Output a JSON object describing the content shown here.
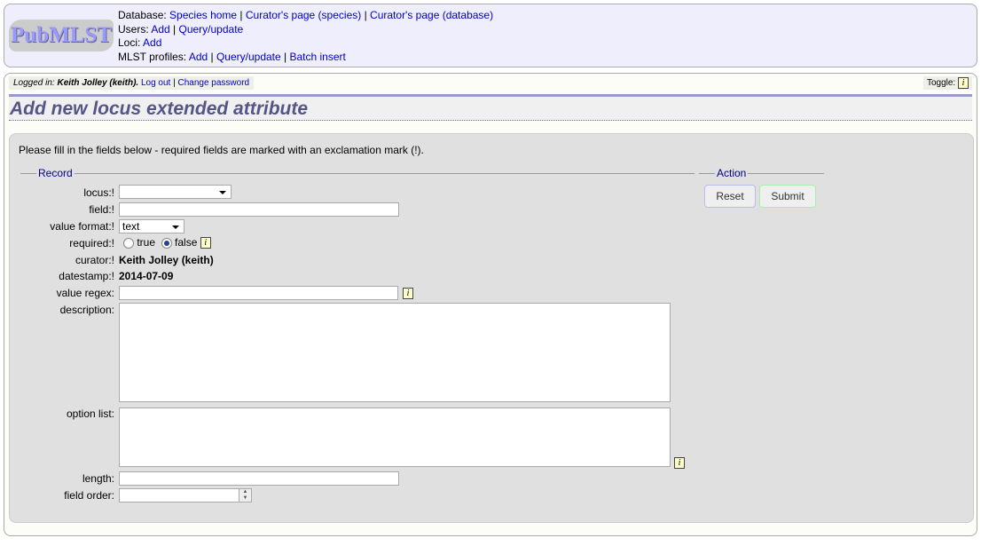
{
  "header": {
    "logo_text": "PubMLST",
    "rows": [
      {
        "label": "Database:",
        "links": [
          "Species home",
          "Curator's page (species)",
          "Curator's page (database)"
        ]
      },
      {
        "label": "Users:",
        "links": [
          "Add",
          "Query/update"
        ]
      },
      {
        "label": "Loci:",
        "links": [
          "Add"
        ]
      },
      {
        "label": "MLST profiles:",
        "links": [
          "Add",
          "Query/update",
          "Batch insert"
        ]
      }
    ]
  },
  "login": {
    "prefix": "Logged in: ",
    "user": "Keith Jolley (keith).",
    "logout": "Log out",
    "change_password": "Change password"
  },
  "toggle": {
    "label": "Toggle:",
    "icon": "info-icon"
  },
  "page_title": "Add new locus extended attribute",
  "form": {
    "intro": "Please fill in the fields below - required fields are marked with an exclamation mark (!).",
    "record_legend": "Record",
    "action_legend": "Action",
    "labels": {
      "locus": "locus:!",
      "field": "field:!",
      "value_format": "value format:!",
      "required": "required:!",
      "curator": "curator:!",
      "datestamp": "datestamp:!",
      "value_regex": "value regex:",
      "description": "description:",
      "option_list": "option list:",
      "length": "length:",
      "field_order": "field order:"
    },
    "values": {
      "locus": "",
      "field": "",
      "value_format": "text",
      "required_true": "true",
      "required_false": "false",
      "required_selected": "false",
      "curator": "Keith Jolley (keith)",
      "datestamp": "2014-07-09",
      "value_regex": "",
      "description": "",
      "option_list": "",
      "length": "",
      "field_order": ""
    },
    "reset": "Reset",
    "submit": "Submit"
  },
  "colors": {
    "header_bg": "#eeeefd",
    "link": "#0000cc",
    "title": "#555588",
    "form_bg": "#e0e0e0"
  }
}
